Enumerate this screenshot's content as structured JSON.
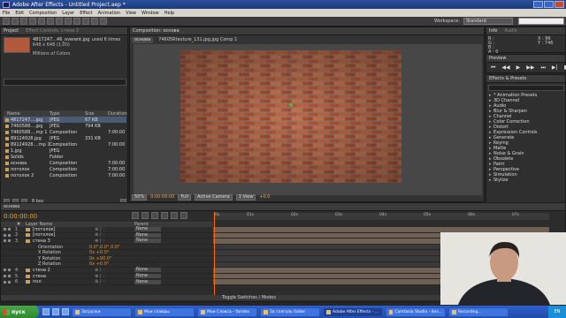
{
  "window": {
    "title": "Adobe After Effects - Untitled Project.aep *"
  },
  "menu": [
    "File",
    "Edit",
    "Composition",
    "Layer",
    "Effect",
    "Animation",
    "View",
    "Window",
    "Help"
  ],
  "toolbar": {
    "workspace_label": "Workspace:",
    "workspace_value": "Standard"
  },
  "project": {
    "tabs": [
      "Project",
      "Effect Controls: стена 3"
    ],
    "selected_name": "4817247...46_overent.jpg",
    "used": "used 6 times",
    "dimensions": "648 x 648 (1,00)",
    "colors": "Millions of Colors",
    "columns": [
      "Name",
      "Type",
      "Size",
      "Duration"
    ],
    "items": [
      {
        "name": "4817247....jpg",
        "type": "JPEG",
        "size": "67 KB",
        "duration": ""
      },
      {
        "name": "7460588....jpg",
        "type": "JPEG",
        "size": "794 KB",
        "duration": ""
      },
      {
        "name": "7460588....mp 1",
        "type": "Composition",
        "size": "",
        "duration": "7:00:00"
      },
      {
        "name": "89124928.jpg",
        "type": "JPEG",
        "size": "331 KB",
        "duration": ""
      },
      {
        "name": "89124928....mp 1",
        "type": "Composition",
        "size": "",
        "duration": "7:00:00"
      },
      {
        "name": "1.jpg",
        "type": "JPEG",
        "size": "",
        "duration": ""
      },
      {
        "name": "Solids",
        "type": "Folder",
        "size": "",
        "duration": ""
      },
      {
        "name": "основа",
        "type": "Composition",
        "size": "",
        "duration": "7:00:00"
      },
      {
        "name": "потолок",
        "type": "Composition",
        "size": "",
        "duration": "7:00:00"
      },
      {
        "name": "потолок 2",
        "type": "Composition",
        "size": "",
        "duration": "7:00:00"
      }
    ],
    "bpc": "8 bpc"
  },
  "composition": {
    "tab": "Composition: основа",
    "subtabs": [
      "основа",
      "74605Rtexture_131.jpg,jpg Comp 1"
    ],
    "zoom": "50%",
    "timecode": "0:00:00:00",
    "resolution": "Full",
    "camera": "Active Camera",
    "views": "1 View",
    "offset": "+0.0"
  },
  "info": {
    "tabs": [
      "Info",
      "Audio"
    ],
    "colors": [
      "R :",
      "G :",
      "B :",
      "A : 0"
    ],
    "coords": [
      "X : 96",
      "Y : 746"
    ]
  },
  "preview": {
    "tab": "Preview",
    "buttons": [
      "⏮",
      "◀◀",
      "▶",
      "▶▶",
      "⏭",
      "▶|",
      "■"
    ]
  },
  "effects": {
    "tab": "Effects & Presets",
    "items": [
      "* Animation Presets",
      "3D Channel",
      "Audio",
      "Blur & Sharpen",
      "Channel",
      "Color Correction",
      "Distort",
      "Expression Controls",
      "Generate",
      "Keying",
      "Matte",
      "Noise & Grain",
      "Obsolete",
      "Paint",
      "Perspective",
      "Simulation",
      "Stylize"
    ]
  },
  "timeline": {
    "tab": "основа",
    "timecode": "0:00:00:00",
    "ruler": [
      "0s",
      "01s",
      "02s",
      "03s",
      "04s",
      "05s",
      "06s",
      "07s"
    ],
    "columns": [
      "#",
      "Layer Name",
      "Parent"
    ],
    "layers": [
      {
        "kind": "layer",
        "num": "1",
        "name": "[потолок]",
        "parent": "None",
        "color": "#c9a05a"
      },
      {
        "kind": "layer",
        "num": "2",
        "name": "[потолок]",
        "parent": "None",
        "color": "#c9a05a"
      },
      {
        "kind": "layer",
        "num": "3",
        "name": "стена 3",
        "parent": "None",
        "color": "#c9a05a"
      },
      {
        "kind": "prop",
        "name": "Orientation",
        "value": "0.0°,0.0°,0.0°"
      },
      {
        "kind": "prop",
        "name": "X Rotation",
        "value": "0x +0.0°"
      },
      {
        "kind": "prop",
        "name": "Y Rotation",
        "value": "0x +90.0°"
      },
      {
        "kind": "prop",
        "name": "Z Rotation",
        "value": "0x +0.0°"
      },
      {
        "kind": "layer",
        "num": "4",
        "name": "стена 2",
        "parent": "None",
        "color": "#c9a05a"
      },
      {
        "kind": "layer",
        "num": "5",
        "name": "стена",
        "parent": "None",
        "color": "#c9a05a"
      },
      {
        "kind": "layer",
        "num": "6",
        "name": "пол",
        "parent": "None",
        "color": "#c9a05a"
      }
    ],
    "footer": "Toggle Switches / Modes"
  },
  "taskbar": {
    "start": "пуск",
    "items": [
      "Загрузки",
      "Мои слайды",
      "Мои Словса - Yandex",
      "За голголь folder",
      "Adobe After Effects - ...",
      "Camtasia Studio - без...",
      "Recording..."
    ],
    "tray": "EN"
  }
}
